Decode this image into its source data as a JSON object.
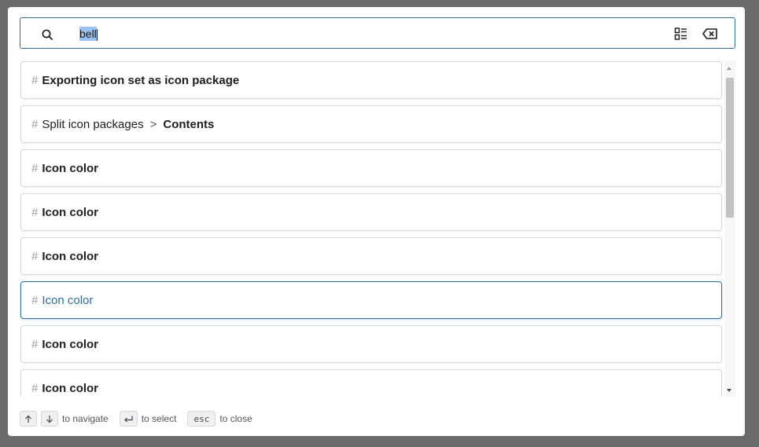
{
  "search": {
    "query": "bell"
  },
  "results": [
    {
      "hash": "#",
      "prefix": "",
      "title": "Exporting icon set as icon package",
      "active": false
    },
    {
      "hash": "#",
      "prefix": "Split icon packages",
      "title": "Contents",
      "active": false
    },
    {
      "hash": "#",
      "prefix": "",
      "title": "Icon color",
      "active": false
    },
    {
      "hash": "#",
      "prefix": "",
      "title": "Icon color",
      "active": false
    },
    {
      "hash": "#",
      "prefix": "",
      "title": "Icon color",
      "active": false
    },
    {
      "hash": "#",
      "prefix": "",
      "title": "Icon color",
      "active": true
    },
    {
      "hash": "#",
      "prefix": "",
      "title": "Icon color",
      "active": false
    },
    {
      "hash": "#",
      "prefix": "",
      "title": "Icon color",
      "active": false
    }
  ],
  "breadcrumb_separator": ">",
  "footer": {
    "navigate_label": "to navigate",
    "select_label": "to select",
    "esc_key": "esc",
    "close_label": "to close"
  },
  "colors": {
    "accent": "#2a6f97",
    "selection": "#9bc1ef",
    "backdrop": "#6b6b6b"
  },
  "icons": {
    "search": "search-icon",
    "toggle": "list-view-toggle-icon",
    "clear": "clear-search-icon"
  }
}
